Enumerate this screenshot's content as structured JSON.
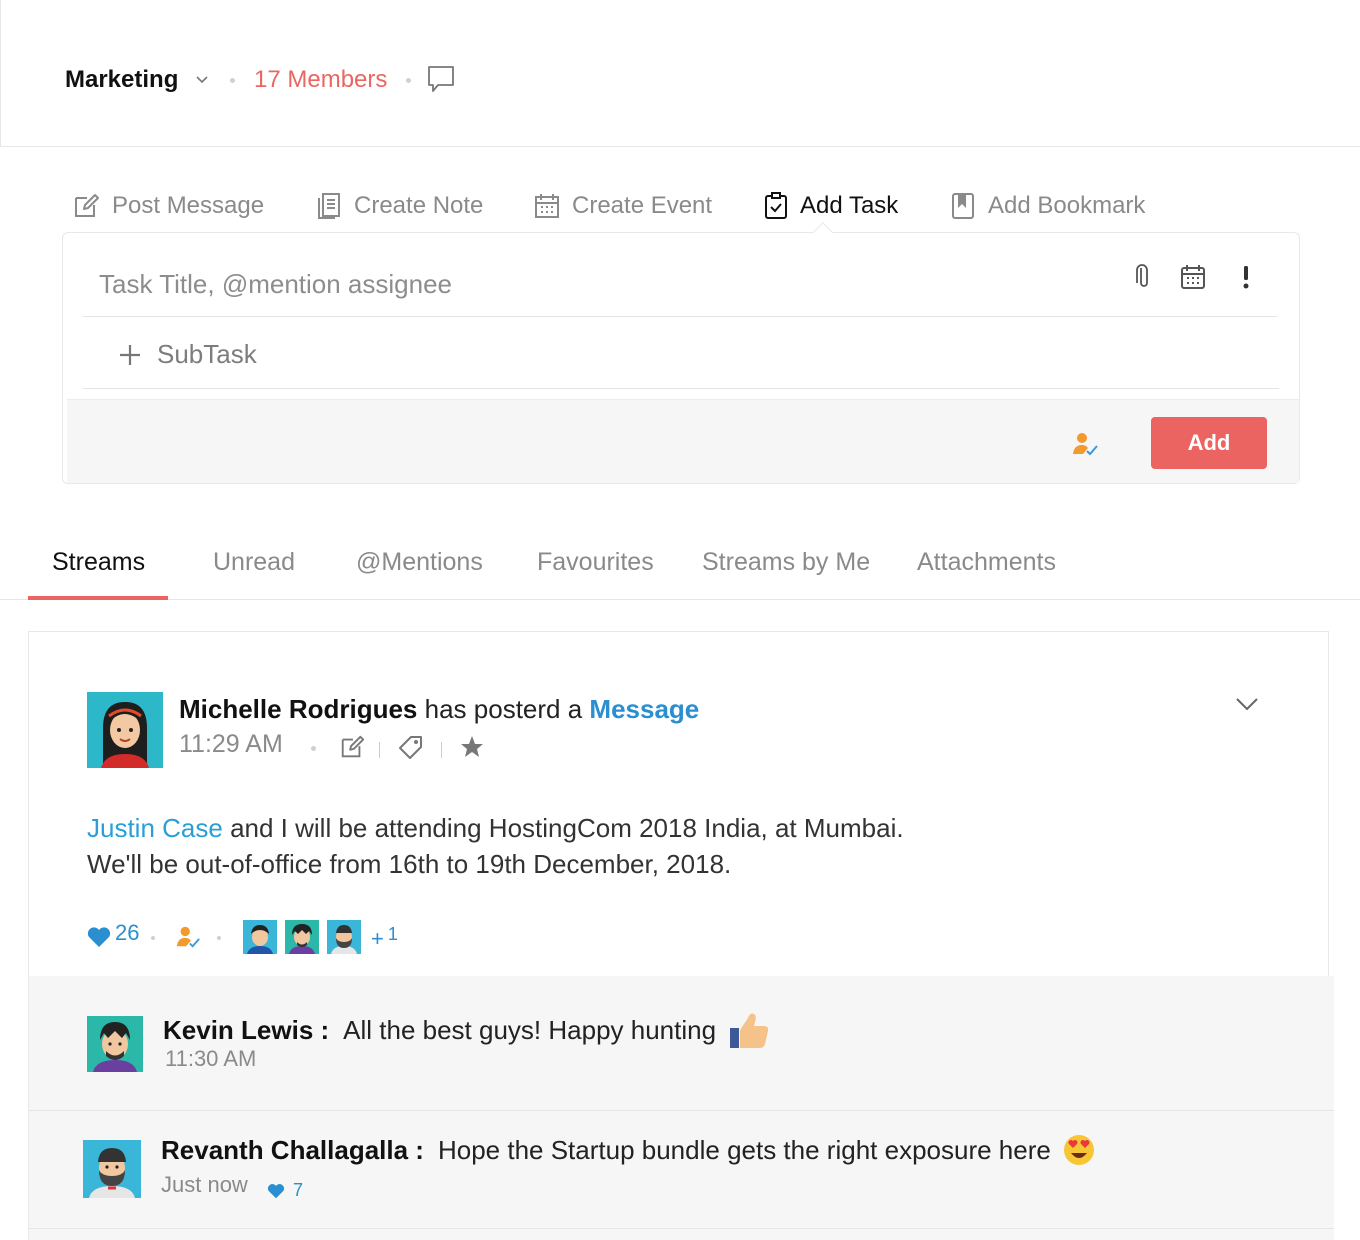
{
  "header": {
    "team_name": "Marketing",
    "members": "17 Members"
  },
  "compose_tabs": [
    {
      "label": "Post Message",
      "icon": "edit-icon"
    },
    {
      "label": "Create Note",
      "icon": "note-icon"
    },
    {
      "label": "Create Event",
      "icon": "calendar-icon"
    },
    {
      "label": "Add Task",
      "icon": "task-clipboard-icon",
      "active": true
    },
    {
      "label": "Add Bookmark",
      "icon": "bookmark-icon"
    }
  ],
  "task_form": {
    "title_placeholder": "Task Title, @mention assignee",
    "subtask_label": "SubTask",
    "add_button": "Add"
  },
  "stream_tabs": [
    {
      "label": "Streams",
      "active": true
    },
    {
      "label": "Unread"
    },
    {
      "label": "@Mentions"
    },
    {
      "label": "Favourites"
    },
    {
      "label": "Streams by Me"
    },
    {
      "label": "Attachments"
    }
  ],
  "post": {
    "author": "Michelle Rodrigues",
    "action": "has posterd a",
    "type": "Message",
    "time": "11:29 AM",
    "body_mention": "Justin Case",
    "body_line1": "and I will be attending HostingCom 2018 India, at Mumbai.",
    "body_line2": "We'll be out-of-office from 16th to 19th December, 2018.",
    "likes": "26",
    "more_viewers": "1"
  },
  "comments": [
    {
      "author": "Kevin Lewis :",
      "text": "All the best guys! Happy hunting",
      "time": "11:30 AM",
      "emoji": "thumbs-up"
    },
    {
      "author": "Revanth Challagalla :",
      "text": "Hope the Startup bundle gets the right exposure here",
      "time": "Just now",
      "likes": "7",
      "emoji": "heart-eyes"
    }
  ],
  "colors": {
    "accent": "#eb6461",
    "link": "#2a8fd0",
    "muted": "#8a8a8a"
  }
}
